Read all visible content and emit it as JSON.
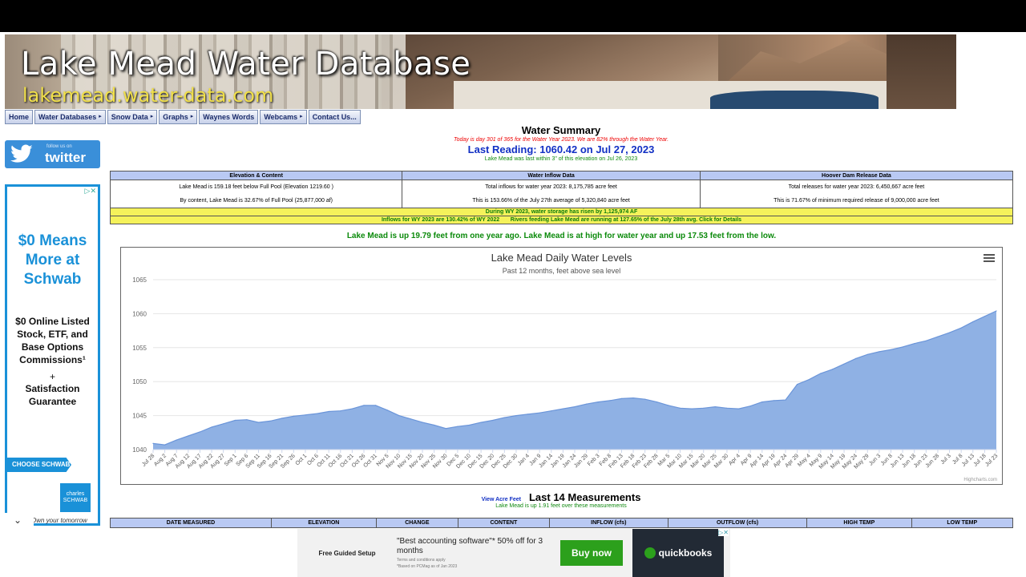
{
  "site": {
    "title": "Lake Mead Water Database",
    "url": "lakemead.water-data.com"
  },
  "nav": [
    {
      "label": "Home",
      "caret": false
    },
    {
      "label": "Water Databases",
      "caret": true
    },
    {
      "label": "Snow Data",
      "caret": true
    },
    {
      "label": "Graphs",
      "caret": true
    },
    {
      "label": "Waynes Words",
      "caret": false
    },
    {
      "label": "Webcams",
      "caret": true
    },
    {
      "label": "Contact Us...",
      "caret": false
    }
  ],
  "twitter": {
    "follow": "follow us on",
    "name": "twitter"
  },
  "side_ad": {
    "headline": "$0 Means More at Schwab",
    "body": "$0 Online Listed Stock, ETF, and Base Options Commissions¹",
    "plus": "+",
    "extra": "Satisfaction Guarantee",
    "cta": "CHOOSE SCHWAB",
    "logo": "charles SCHWAB",
    "tagline": "Own your tomorrow"
  },
  "summary": {
    "heading": "Water Summary",
    "day_note": "Today is day 301 of 365 for the Water Year 2023. We are 82% through the Water Year.",
    "last_reading": "Last Reading: 1060.42 on Jul 27, 2023",
    "within_note": "Lake Mead was last within 3\" of this elevation on Jul 26, 2023"
  },
  "info_table": {
    "headers": [
      "Elevation & Content",
      "Water Inflow Data",
      "Hoover Dam Release Data"
    ],
    "elevation": [
      "Lake Mead is 159.18 feet below Full Pool (Elevation 1219.60 )",
      "By content, Lake Mead is 32.67% of Full Pool (25,877,000 af)"
    ],
    "inflow": [
      "Total inflows for water year 2023: 8,175,785 acre feet",
      "This is 153.66% of the July 27th average of 5,320,840 acre feet"
    ],
    "release": [
      "Total releases for water year 2023: 6,450,667 acre feet",
      "This is 71.67% of minimum required release of 9,000,000 acre feet"
    ],
    "storage_row": "During WY 2023, water storage has risen by 1,125,974 AF",
    "inflow_row_a": "Inflows for WY 2023 are 130.42% of WY 2022",
    "inflow_row_b": "Rivers feeding Lake Mead are running at 127.65% of the July 28th avg. Click for Details"
  },
  "up_line": "Lake Mead is up 19.79 feet from one year ago.   Lake Mead is at high for water year and up 17.53 feet from the low.",
  "chart_data": {
    "type": "area",
    "title": "Lake Mead Daily Water Levels",
    "subtitle": "Past 12 months, feet above sea level",
    "ylim": [
      1040,
      1065
    ],
    "yticks": [
      1040,
      1045,
      1050,
      1055,
      1060,
      1065
    ],
    "x_ticks": [
      "Jul 28",
      "Aug 2",
      "Aug 7",
      "Aug 12",
      "Aug 17",
      "Aug 22",
      "Aug 27",
      "Sep 1",
      "Sep 6",
      "Sep 11",
      "Sep 16",
      "Sep 21",
      "Sep 26",
      "Oct 1",
      "Oct 6",
      "Oct 11",
      "Oct 16",
      "Oct 21",
      "Oct 26",
      "Oct 31",
      "Nov 5",
      "Nov 10",
      "Nov 15",
      "Nov 20",
      "Nov 25",
      "Nov 30",
      "Dec 5",
      "Dec 10",
      "Dec 15",
      "Dec 20",
      "Dec 25",
      "Dec 30",
      "Jan 4",
      "Jan 9",
      "Jan 14",
      "Jan 19",
      "Jan 24",
      "Jan 29",
      "Feb 3",
      "Feb 8",
      "Feb 13",
      "Feb 18",
      "Feb 23",
      "Feb 28",
      "Mar 5",
      "Mar 10",
      "Mar 15",
      "Mar 20",
      "Mar 25",
      "Mar 30",
      "Apr 4",
      "Apr 9",
      "Apr 14",
      "Apr 19",
      "Apr 24",
      "Apr 29",
      "May 4",
      "May 9",
      "May 14",
      "May 19",
      "May 24",
      "May 29",
      "Jun 3",
      "Jun 8",
      "Jun 13",
      "Jun 18",
      "Jun 23",
      "Jun 28",
      "Jul 3",
      "Jul 8",
      "Jul 13",
      "Jul 18",
      "Jul 23"
    ],
    "values": [
      1040.9,
      1040.7,
      1041.4,
      1042.0,
      1042.6,
      1043.3,
      1043.8,
      1044.3,
      1044.4,
      1044.0,
      1044.2,
      1044.6,
      1044.9,
      1045.1,
      1045.3,
      1045.6,
      1045.7,
      1046.0,
      1046.5,
      1046.5,
      1045.8,
      1045.0,
      1044.5,
      1044.0,
      1043.6,
      1043.1,
      1043.4,
      1043.6,
      1044.0,
      1044.3,
      1044.7,
      1045.0,
      1045.2,
      1045.4,
      1045.7,
      1046.0,
      1046.3,
      1046.7,
      1047.0,
      1047.2,
      1047.5,
      1047.6,
      1047.4,
      1047.0,
      1046.5,
      1046.1,
      1046.0,
      1046.1,
      1046.3,
      1046.1,
      1046.0,
      1046.4,
      1047.0,
      1047.2,
      1047.3,
      1049.6,
      1050.3,
      1051.2,
      1051.8,
      1052.6,
      1053.4,
      1054.0,
      1054.4,
      1054.7,
      1055.1,
      1055.6,
      1056.0,
      1056.6,
      1057.2,
      1057.9,
      1058.8,
      1059.6,
      1060.4
    ]
  },
  "credits": "Highcharts.com",
  "measurements": {
    "view_link": "View Acre Feet",
    "title": "Last 14 Measurements",
    "sub": "Lake Mead is up 1.91 feet over these measurements",
    "headers": [
      "DATE MEASURED",
      "ELEVATION",
      "CHANGE",
      "CONTENT",
      "INFLOW (cfs)",
      "OUTFLOW (cfs)",
      "HIGH TEMP",
      "LOW TEMP"
    ]
  },
  "bottom_ad": {
    "left": "Free Guided Setup",
    "quote": "\"Best accounting software\"* 50% off for 3 months",
    "fine1": "Terms and conditions apply",
    "fine2": "*Based on PCMag as of Jan 2023",
    "button": "Buy now",
    "brand": "quickbooks"
  },
  "colors": {
    "area_fill": "#8fb1e4",
    "area_line": "#6b95d9",
    "header_blue": "#b9c9f3",
    "highlight": "#f5f25b",
    "green_text": "#0b8a0b"
  }
}
